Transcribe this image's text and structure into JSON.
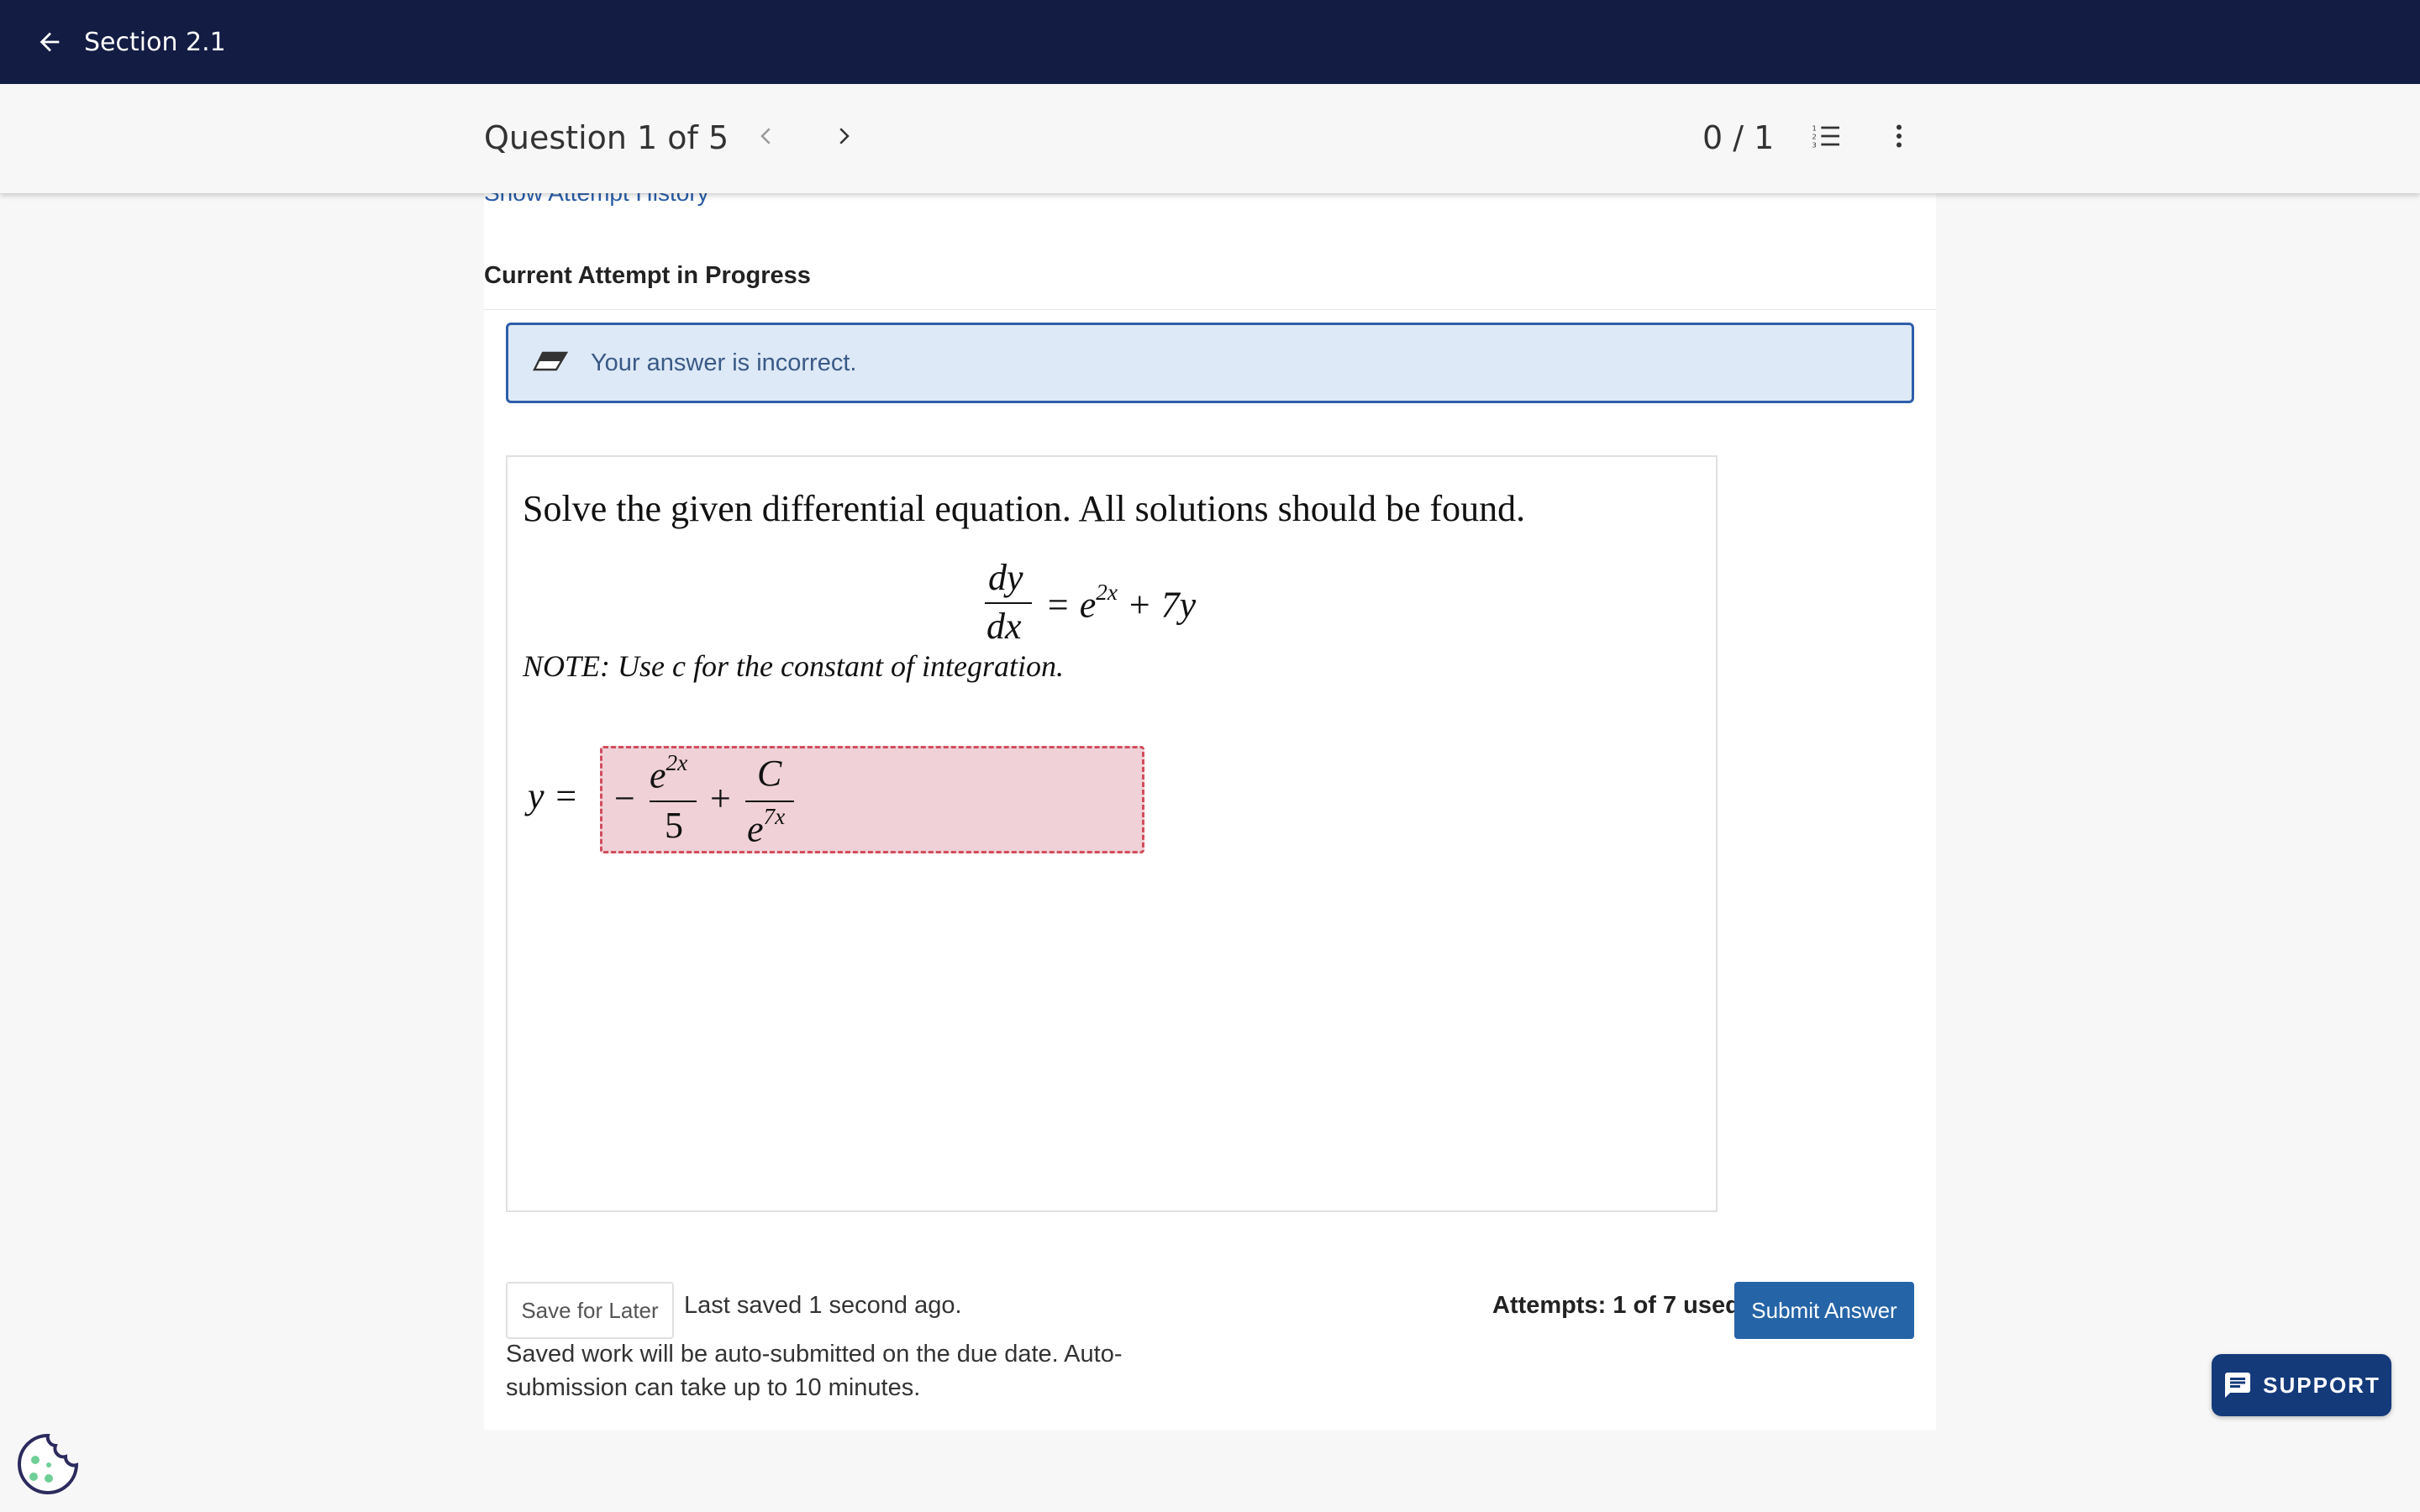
{
  "topbar": {
    "title": "Section 2.1"
  },
  "question_nav": {
    "label": "Question 1 of 5",
    "score": "0 / 1"
  },
  "attempt": {
    "history_link": "Show Attempt History",
    "heading": "Current Attempt in Progress",
    "feedback": "Your answer is incorrect."
  },
  "question": {
    "prompt": "Solve the given differential equation. All solutions should be found.",
    "equation": {
      "numerator": "dy",
      "denominator": "dx",
      "rhs_base": "= e",
      "rhs_exp": "2x",
      "rhs_tail": " + 7y"
    },
    "note": "NOTE: Use c for the constant of integration.",
    "answer_label": "y =",
    "answer": {
      "minus": "−",
      "term1_base": "e",
      "term1_exp": "2x",
      "term1_den": "5",
      "plus": "+",
      "term2_num": "C",
      "term2_den_base": "e",
      "term2_den_exp": "7x"
    }
  },
  "footer": {
    "save_label": "Save for Later",
    "last_saved": "Last saved 1 second ago.",
    "autosubmit_note": "Saved work will be auto-submitted on the due date. Auto-submission can take up to 10 minutes.",
    "attempts": "Attempts: 1 of 7 used",
    "submit_label": "Submit Answer"
  },
  "support": {
    "label": "SUPPORT"
  },
  "icons": [
    "arrow-back-icon",
    "chevron-left-icon",
    "chevron-right-icon",
    "numbered-list-icon",
    "more-vertical-icon",
    "eraser-icon",
    "chat-icon",
    "cookie-icon"
  ],
  "colors": {
    "topbar": "#131c43",
    "feedback_bg": "#dde9f6",
    "feedback_border": "#2e5eaa",
    "answer_incorrect_bg": "#efd1d7",
    "answer_incorrect_border": "#d14d5d",
    "submit": "#2564a6",
    "support": "#143a7a"
  }
}
